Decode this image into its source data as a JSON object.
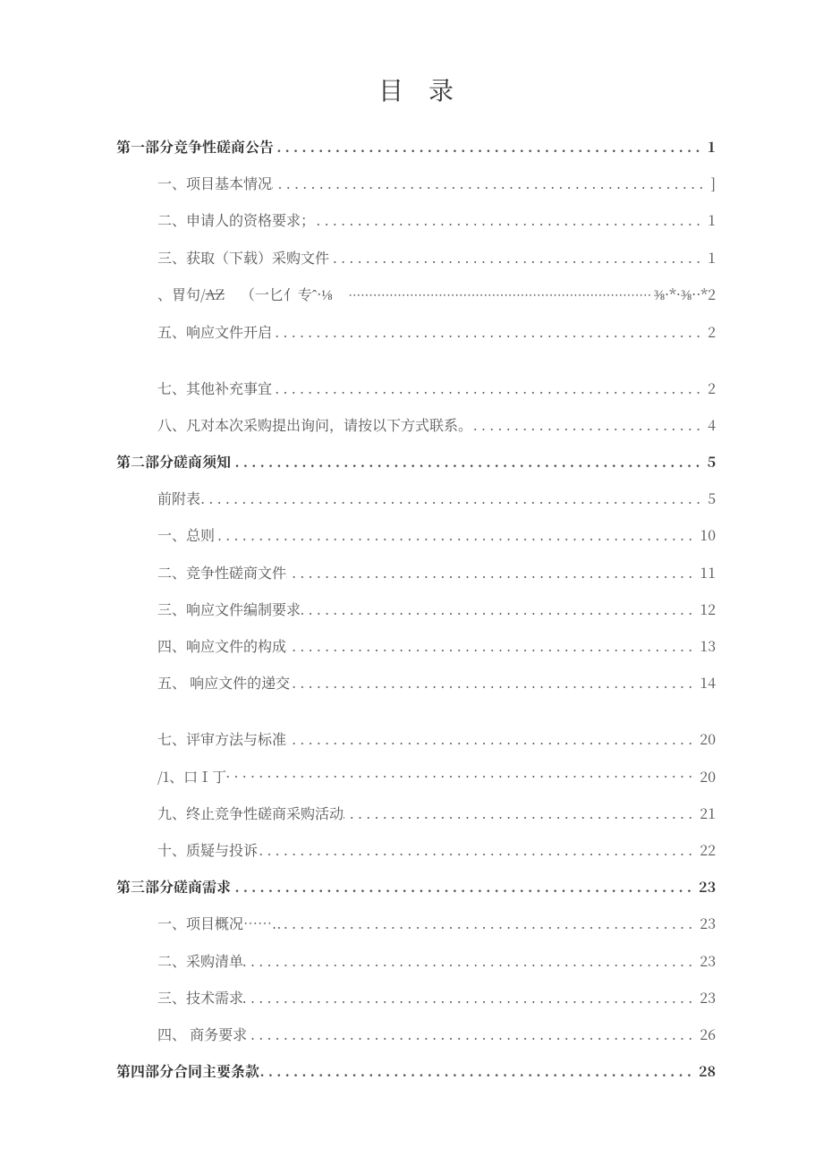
{
  "title": "目录",
  "toc": [
    {
      "level": 1,
      "text": "第一部分竞争性磋商公告",
      "page": "1"
    },
    {
      "level": 2,
      "text": "一、项目基本情况",
      "page": "]"
    },
    {
      "level": 2,
      "text": "二、申请人的资格要求；",
      "page": "1"
    },
    {
      "level": 2,
      "text": "三、获取（下载）采购文件",
      "page": "1"
    },
    {
      "level": 2,
      "garbled": true,
      "left": "、胃句/",
      "strike": "AZ",
      "mid": "（一匕亻专ˆ·⅛",
      "right": "⅜·*·⅜··*2"
    },
    {
      "level": 2,
      "text": "五、响应文件开启",
      "page": "2"
    },
    {
      "gap": true
    },
    {
      "level": 2,
      "text": "七、其他补充事宜",
      "page": "2"
    },
    {
      "level": 2,
      "text": "八、凡对本次采购提出询问，请按以下方式联系。",
      "page": "4"
    },
    {
      "level": 1,
      "text": "第二部分磋商须知",
      "page": "5"
    },
    {
      "level": 2,
      "text": "前附表",
      "page": "5"
    },
    {
      "level": 2,
      "text": "一、总则",
      "page": "10"
    },
    {
      "level": 2,
      "text": "二、竞争性磋商文件",
      "page": "11"
    },
    {
      "level": 2,
      "text": "三、响应文件编制要求",
      "page": "12"
    },
    {
      "level": 2,
      "text": "四、响应文件的构成",
      "page": "13"
    },
    {
      "level": 2,
      "text": "五、 响应文件的递交",
      "page": "14"
    },
    {
      "gap": true
    },
    {
      "level": 2,
      "text": "七、评审方法与标准",
      "page": "20"
    },
    {
      "level": 2,
      "alt": true,
      "text": "/1、口Ⅰ丁",
      "page": "20"
    },
    {
      "level": 2,
      "text": "九、终止竞争性磋商采购活动",
      "page": "21"
    },
    {
      "level": 2,
      "text": "十、质疑与投诉",
      "page": "22"
    },
    {
      "level": 1,
      "text": "第三部分磋商需求",
      "page": "23"
    },
    {
      "level": 2,
      "text": "一、项目概况……..",
      "page": "23"
    },
    {
      "level": 2,
      "text": "二、采购清单",
      "page": "23"
    },
    {
      "level": 2,
      "text": "三、技术需求 ",
      "page": "23"
    },
    {
      "level": 2,
      "text": "四、 商务要求",
      "page": "26"
    },
    {
      "level": 1,
      "text": "第四部分合同主要条款",
      "page": "28"
    }
  ]
}
